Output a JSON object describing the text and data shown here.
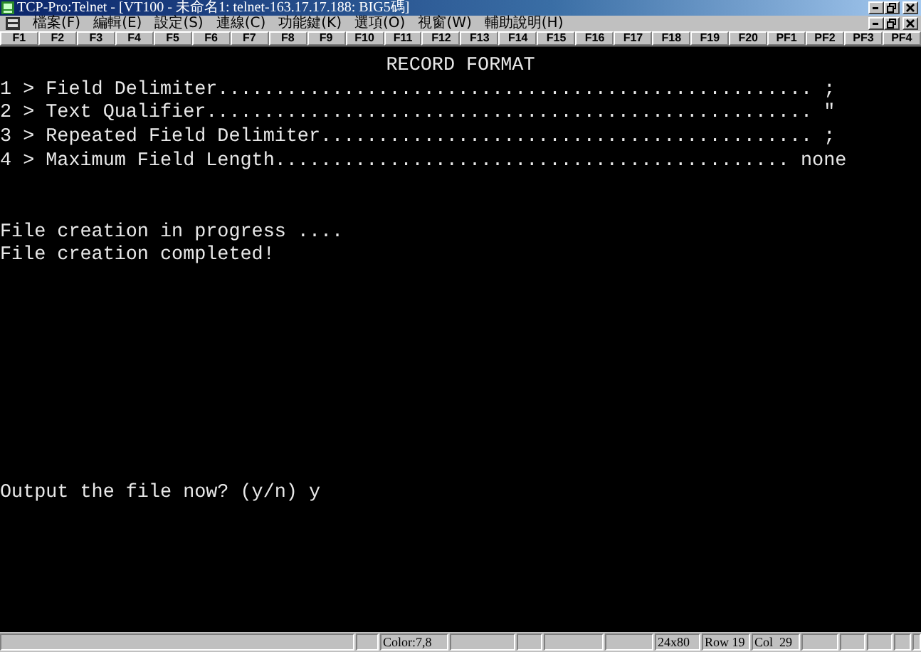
{
  "window": {
    "title": "TCP-Pro:Telnet - [VT100 - 未命名1: telnet-163.17.17.188: BIG5碼]"
  },
  "menu": [
    "檔案(F)",
    "編輯(E)",
    "設定(S)",
    "連線(C)",
    "功能鍵(K)",
    "選項(O)",
    "視窗(W)",
    "輔助說明(H)"
  ],
  "function_keys": [
    "F1",
    "F2",
    "F3",
    "F4",
    "F5",
    "F6",
    "F7",
    "F8",
    "F9",
    "F10",
    "F11",
    "F12",
    "F13",
    "F14",
    "F15",
    "F16",
    "F17",
    "F18",
    "F19",
    "F20",
    "PF1",
    "PF2",
    "PF3",
    "PF4"
  ],
  "terminal": {
    "heading": "RECORD FORMAT",
    "options": [
      "1 > Field Delimiter.................................................... ;",
      "2 > Text Qualifier..................................................... \"",
      "3 > Repeated Field Delimiter........................................... ;",
      "4 > Maximum Field Length............................................. none"
    ],
    "messages": [
      "File creation in progress ....",
      "File creation completed!"
    ],
    "prompt": "Output the file now? (y/n) y"
  },
  "status_bar": {
    "color_setting": "Color:7,8",
    "size": "24x80",
    "row": "Row 19",
    "col": "Col  29"
  }
}
